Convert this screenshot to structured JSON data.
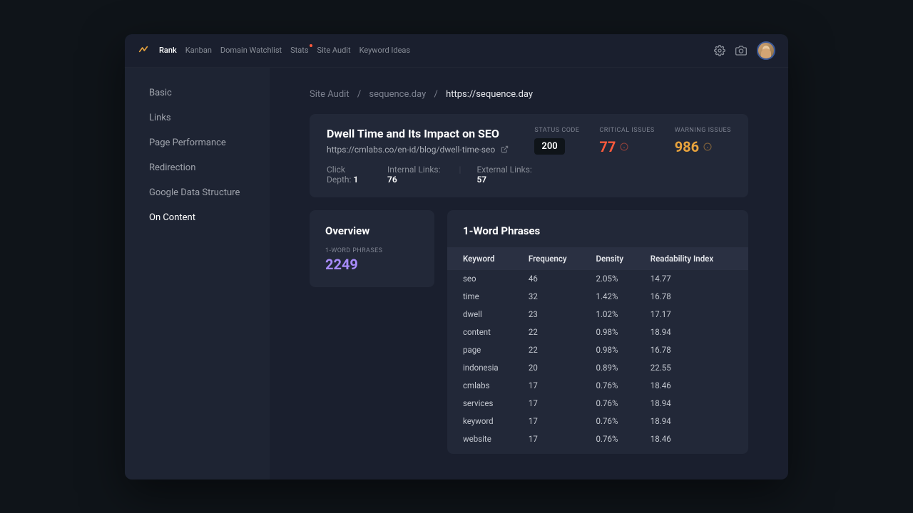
{
  "nav": {
    "items": [
      "Rank",
      "Kanban",
      "Domain Watchlist",
      "Stats",
      "Site Audit",
      "Keyword Ideas"
    ],
    "active": 0,
    "stats_dot_index": 3
  },
  "sidebar": {
    "items": [
      "Basic",
      "Links",
      "Page Performance",
      "Redirection",
      "Google Data Structure",
      "On Content"
    ],
    "active": 5
  },
  "breadcrumb": {
    "parts": [
      "Site Audit",
      "sequence.day",
      "https://sequence.day"
    ]
  },
  "header": {
    "title": "Dwell Time and Its Impact on SEO",
    "url": "https://cmlabs.co/en-id/blog/dwell-time-seo",
    "click_depth_label": "Click Depth:",
    "click_depth": "1",
    "internal_links_label": "Internal Links:",
    "internal_links": "76",
    "external_links_label": "External Links:",
    "external_links": "57",
    "status_label": "STATUS CODE",
    "status_value": "200",
    "critical_label": "CRITICAL ISSUES",
    "critical_value": "77",
    "warning_label": "WARNING ISSUES",
    "warning_value": "986"
  },
  "overview": {
    "title": "Overview",
    "sub_label": "1-WORD PHRASES",
    "value": "2249"
  },
  "table": {
    "title": "1-Word Phrases",
    "columns": [
      "Keyword",
      "Frequency",
      "Density",
      "Readability Index"
    ],
    "rows": [
      {
        "k": "seo",
        "f": "46",
        "d": "2.05%",
        "r": "14.77"
      },
      {
        "k": "time",
        "f": "32",
        "d": "1.42%",
        "r": "16.78"
      },
      {
        "k": "dwell",
        "f": "23",
        "d": "1.02%",
        "r": "17.17"
      },
      {
        "k": "content",
        "f": "22",
        "d": "0.98%",
        "r": "18.94"
      },
      {
        "k": "page",
        "f": "22",
        "d": "0.98%",
        "r": "16.78"
      },
      {
        "k": "indonesia",
        "f": "20",
        "d": "0.89%",
        "r": "22.55"
      },
      {
        "k": "cmlabs",
        "f": "17",
        "d": "0.76%",
        "r": "18.46"
      },
      {
        "k": "services",
        "f": "17",
        "d": "0.76%",
        "r": "18.94"
      },
      {
        "k": "keyword",
        "f": "17",
        "d": "0.76%",
        "r": "18.94"
      },
      {
        "k": "website",
        "f": "17",
        "d": "0.76%",
        "r": "18.46"
      }
    ]
  }
}
